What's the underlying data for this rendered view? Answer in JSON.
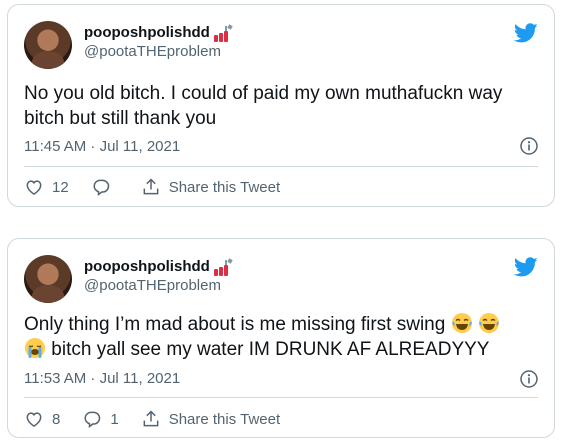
{
  "tweets": [
    {
      "display_name": "pooposhpolishdd",
      "handle": "@pootaTHEproblem",
      "text": "No you old bitch. I could of paid my own muthafuckn way bitch but still thank you",
      "timestamp": "11:45 AM · Jul 11, 2021",
      "likes": "12",
      "replies": "",
      "share_label": "Share this Tweet"
    },
    {
      "display_name": "pooposhpolishdd",
      "handle": "@pootaTHEproblem",
      "text_before": "Only thing I’m mad about is me missing first swing",
      "text_after": "bitch yall see my water IM DRUNK AF ALREADYYY",
      "timestamp": "11:53 AM · Jul 11, 2021",
      "likes": "8",
      "replies": "1",
      "share_label": "Share this Tweet"
    }
  ],
  "icons": {
    "brand": "twitter-bird-icon",
    "nail_polish": "nail-polish-emoji",
    "laughing": "face-with-tears-of-joy-emoji",
    "crying": "loudly-crying-face-emoji",
    "like": "heart-icon",
    "reply": "reply-bubble-icon",
    "share": "share-icon",
    "info": "info-icon"
  },
  "colors": {
    "brand_blue": "#1d9bf0",
    "muted_text": "#536471",
    "border": "#cfd9de"
  }
}
